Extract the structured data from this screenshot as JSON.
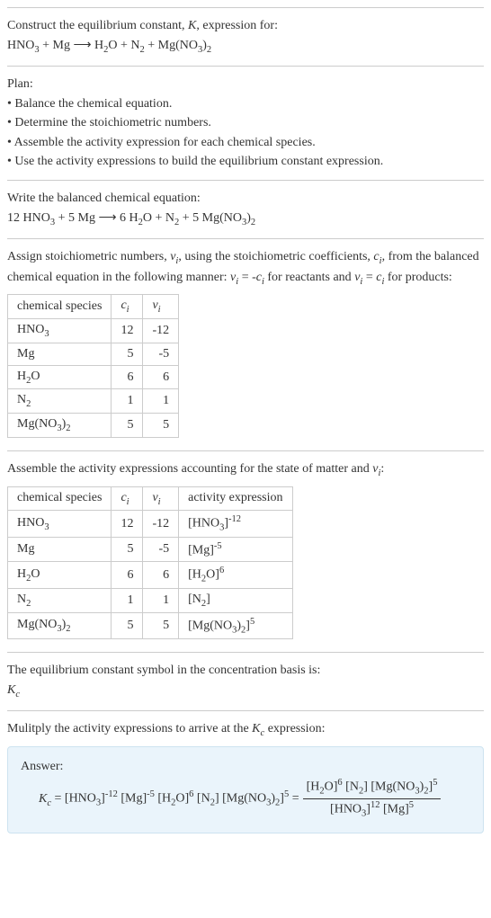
{
  "intro": {
    "prompt": "Construct the equilibrium constant, K, expression for:",
    "equation": "HNO₃ + Mg ⟶ H₂O + N₂ + Mg(NO₃)₂"
  },
  "plan": {
    "heading": "Plan:",
    "bullets": [
      "• Balance the chemical equation.",
      "• Determine the stoichiometric numbers.",
      "• Assemble the activity expression for each chemical species.",
      "• Use the activity expressions to build the equilibrium constant expression."
    ]
  },
  "balanced": {
    "heading": "Write the balanced chemical equation:",
    "equation": "12 HNO₃ + 5 Mg ⟶ 6 H₂O + N₂ + 5 Mg(NO₃)₂"
  },
  "stoich": {
    "heading_pre": "Assign stoichiometric numbers, ",
    "heading_mid1": ", using the stoichiometric coefficients, ",
    "heading_mid2": ", from the balanced chemical equation in the following manner: ",
    "heading_mid3": " for reactants and ",
    "heading_end": " for products:",
    "table": {
      "headers": [
        "chemical species",
        "cᵢ",
        "νᵢ"
      ],
      "rows": [
        {
          "species": "HNO₃",
          "c": "12",
          "v": "-12"
        },
        {
          "species": "Mg",
          "c": "5",
          "v": "-5"
        },
        {
          "species": "H₂O",
          "c": "6",
          "v": "6"
        },
        {
          "species": "N₂",
          "c": "1",
          "v": "1"
        },
        {
          "species": "Mg(NO₃)₂",
          "c": "5",
          "v": "5"
        }
      ]
    }
  },
  "activity": {
    "heading": "Assemble the activity expressions accounting for the state of matter and νᵢ:",
    "table": {
      "headers": [
        "chemical species",
        "cᵢ",
        "νᵢ",
        "activity expression"
      ],
      "rows": [
        {
          "species": "HNO₃",
          "c": "12",
          "v": "-12",
          "expr": "[HNO₃]⁻¹²"
        },
        {
          "species": "Mg",
          "c": "5",
          "v": "-5",
          "expr": "[Mg]⁻⁵"
        },
        {
          "species": "H₂O",
          "c": "6",
          "v": "6",
          "expr": "[H₂O]⁶"
        },
        {
          "species": "N₂",
          "c": "1",
          "v": "1",
          "expr": "[N₂]"
        },
        {
          "species": "Mg(NO₃)₂",
          "c": "5",
          "v": "5",
          "expr": "[Mg(NO₃)₂]⁵"
        }
      ]
    }
  },
  "symbol": {
    "line1": "The equilibrium constant symbol in the concentration basis is:",
    "line2": "K_c"
  },
  "multiply": {
    "heading": "Mulitply the activity expressions to arrive at the K_c expression:"
  },
  "answer": {
    "label": "Answer:",
    "left": "K_c = [HNO₃]⁻¹² [Mg]⁻⁵ [H₂O]⁶ [N₂] [Mg(NO₃)₂]⁵ = ",
    "numerator": "[H₂O]⁶ [N₂] [Mg(NO₃)₂]⁵",
    "denominator": "[HNO₃]¹² [Mg]⁵"
  }
}
